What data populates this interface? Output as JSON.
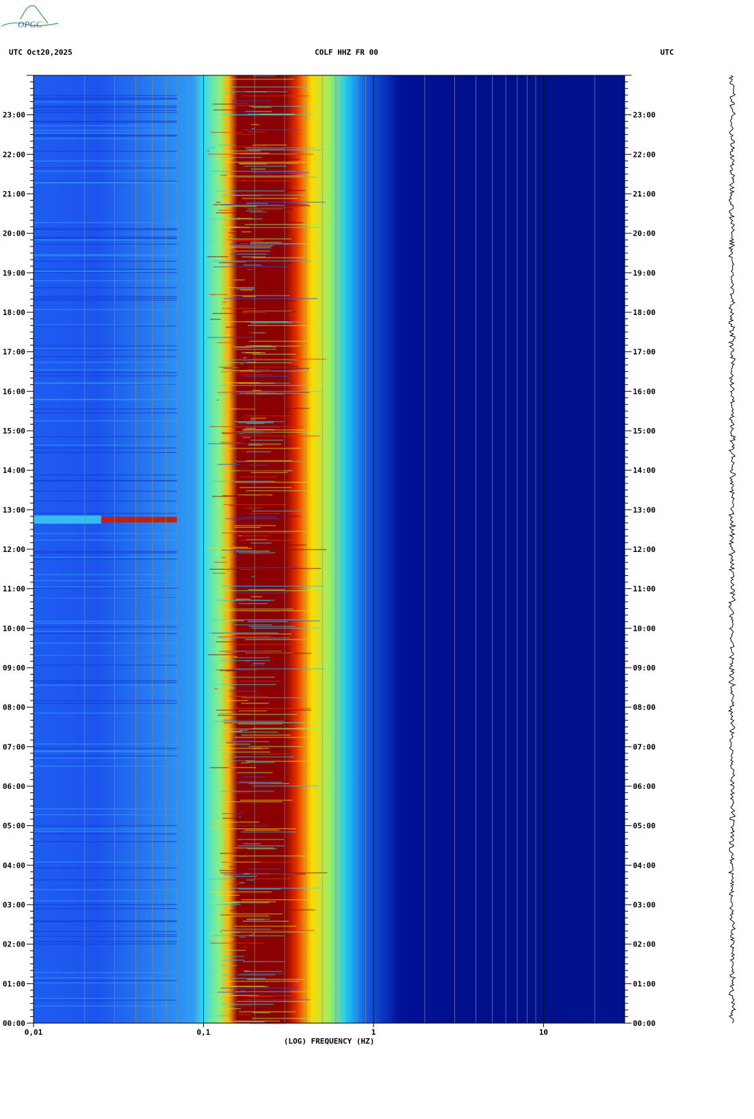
{
  "logo": {
    "text": "OPGC",
    "icon": "opgc-logo-icon"
  },
  "header": {
    "left": "UTC  Oct20,2025",
    "center": "COLF HHZ FR 00",
    "right": "UTC"
  },
  "chart_data": {
    "type": "heatmap",
    "title": "COLF HHZ FR 00",
    "date": "Oct20,2025",
    "xlabel": "(LOG) FREQUENCY (HZ)",
    "x_scale": "log",
    "xlim": [
      0.01,
      30
    ],
    "x_ticks": [
      {
        "value": 0.01,
        "label": "0,01"
      },
      {
        "value": 0.1,
        "label": "0,1"
      },
      {
        "value": 1,
        "label": "1"
      },
      {
        "value": 10,
        "label": "10"
      }
    ],
    "ylabel_left": "UTC",
    "ylabel_right": "UTC",
    "ylim_hours": [
      0,
      24
    ],
    "y_ticks": [
      "00:00",
      "01:00",
      "02:00",
      "03:00",
      "04:00",
      "05:00",
      "06:00",
      "07:00",
      "08:00",
      "09:00",
      "10:00",
      "11:00",
      "12:00",
      "13:00",
      "14:00",
      "15:00",
      "16:00",
      "17:00",
      "18:00",
      "19:00",
      "20:00",
      "21:00",
      "22:00",
      "23:00"
    ],
    "colormap": "jet",
    "dominant_band_hz": [
      0.15,
      0.3
    ],
    "notable_event": {
      "time": "12:45",
      "freq_range_hz": [
        0.025,
        0.07
      ]
    },
    "trace": "right-side seismogram trace"
  }
}
